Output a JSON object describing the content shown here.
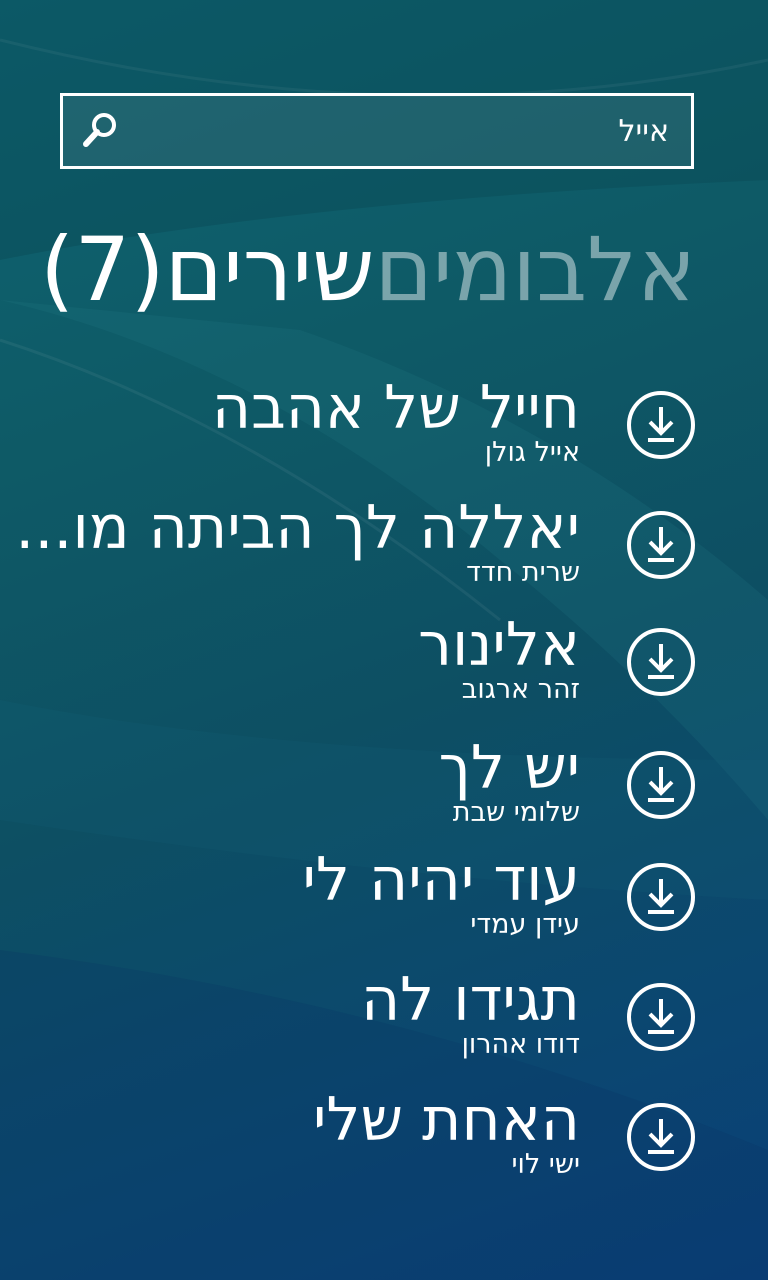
{
  "search": {
    "value": "אייל",
    "icon": "search-icon"
  },
  "pivot": {
    "active_label": "שירים(7)",
    "next_label": "אלבומים"
  },
  "songs": [
    {
      "title": "חייל של אהבה",
      "artist": "אייל גולן"
    },
    {
      "title": "יאללה לך הביתה מו...",
      "artist": "שרית חדד"
    },
    {
      "title": "אלינור",
      "artist": "זהר ארגוב"
    },
    {
      "title": "יש לך",
      "artist": "שלומי שבת"
    },
    {
      "title": "עוד יהיה לי",
      "artist": "עידן עמדי"
    },
    {
      "title": "תגידו לה",
      "artist": "דודו אהרון"
    },
    {
      "title": "האחת שלי",
      "artist": "ישי לוי"
    }
  ],
  "icons": {
    "download": "download-icon"
  },
  "colors": {
    "text": "#ffffff",
    "inactive_text": "#9fb9bd",
    "background_top": "#0f6472",
    "background_bottom": "#0a3f78"
  }
}
